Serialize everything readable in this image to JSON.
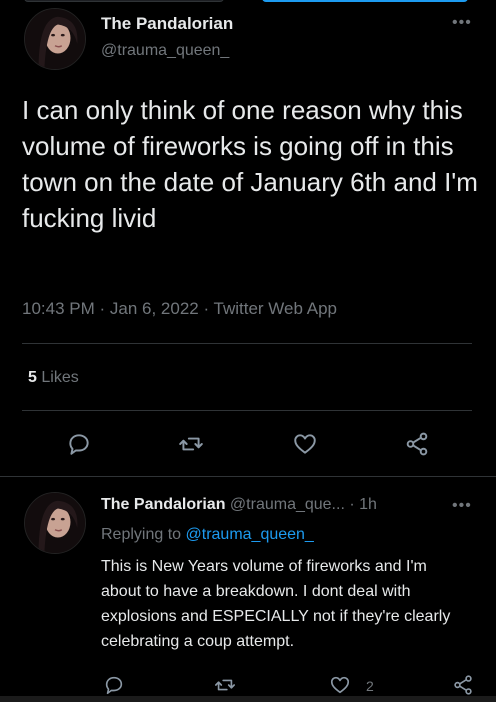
{
  "tweet": {
    "display_name": "The Pandalorian",
    "handle": "@trauma_queen_",
    "more_icon": "ellipsis-icon",
    "text": "I can only think of one reason why this volume of fireworks is going off in this town on the date of January 6th and I'm fucking livid",
    "meta": "10:43 PM · Jan 6, 2022 · Twitter Web App",
    "likes_count": "5",
    "likes_label": "Likes"
  },
  "actions": {
    "reply_icon": "reply-icon",
    "retweet_icon": "retweet-icon",
    "like_icon": "heart-icon",
    "share_icon": "share-icon"
  },
  "reply": {
    "display_name": "The Pandalorian",
    "handle_time": "@trauma_que... · 1h",
    "replying_prefix": "Replying to",
    "replying_to": "@trauma_queen_",
    "text": "This is New Years volume of fireworks and I'm about to have a breakdown. I dont deal with explosions and ESPECIALLY not if they're clearly celebrating a coup attempt.",
    "like_count": "2"
  },
  "colors": {
    "background": "#000000",
    "text": "#e7e9ea",
    "muted": "#71767b",
    "link": "#1d9bf0",
    "divider": "#2f3336"
  }
}
